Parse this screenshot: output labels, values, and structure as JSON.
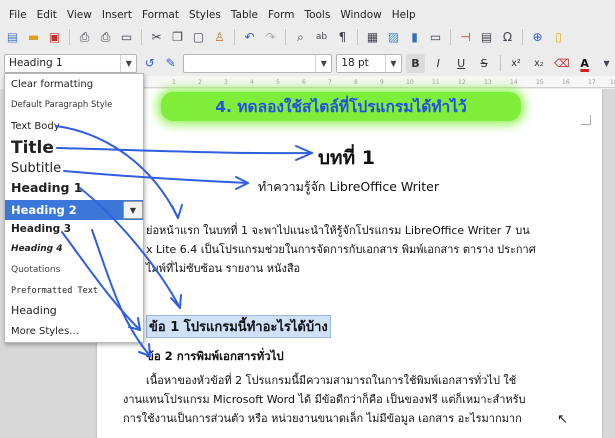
{
  "menubar": [
    "File",
    "Edit",
    "View",
    "Insert",
    "Format",
    "Styles",
    "Table",
    "Form",
    "Tools",
    "Window",
    "Help"
  ],
  "toolbar1_icons": [
    "new-document-icon",
    "open-icon",
    "save-icon",
    "export-pdf-icon",
    "print-icon",
    "print-preview-icon",
    "cut-icon",
    "copy-icon",
    "paste-icon",
    "clone-formatting-icon",
    "undo-icon",
    "redo-icon",
    "find-replace-icon",
    "spelling-icon",
    "formatting-marks-icon",
    "insert-table-icon",
    "insert-image-icon",
    "insert-chart-icon",
    "insert-textbox-icon",
    "page-break-icon",
    "insert-field-icon",
    "special-character-icon",
    "hyperlink-icon",
    "comment-icon"
  ],
  "toolbar2": {
    "paragraph_style": "Heading 1",
    "font_name": "",
    "font_size": "18 pt",
    "bold": "B",
    "italic": "I",
    "underline": "U",
    "strike": "S",
    "superscript": "x²",
    "subscript": "x₂"
  },
  "ruler_marks": [
    "1",
    "2",
    "3",
    "4",
    "5",
    "6",
    "7",
    "8",
    "9",
    "10",
    "11",
    "12",
    "13",
    "14",
    "15",
    "16",
    "17",
    "18"
  ],
  "dropdown": {
    "items": [
      "Clear formatting",
      "Default Paragraph Style",
      "Text Body",
      "Title",
      "Subtitle",
      "Heading 1",
      "Heading 2",
      "Heading 3",
      "Heading 4",
      "Quotations",
      "Preformatted Text",
      "Heading",
      "More Styles..."
    ],
    "selected": "Heading 2"
  },
  "document": {
    "banner": "4. ทดลองใช้สไตล์ที่โปรแกรมได้ทำไว้",
    "title": "บทที่ 1",
    "subtitle": "ทำความรู้จัก LibreOffice Writer",
    "body1": "ย่อหน้าแรก ในบทที่ 1 จะพาไปแนะนำให้รู้จักโปรแกรม LibreOffice Writer 7 บน",
    "body2": "x Lite 6.4 เป็นโปรแกรมช่วยในการจัดการกับเอกสาร พิมพ์เอกสาร ตาราง ประกาศ",
    "body3": "ไมพ์ที่ไม่ซับซ้อน รายงาน หนังสือ",
    "heading2": "ข้อ 1 โปรแกรมนี้ทำอะไรได้บ้าง",
    "heading3": "ข้อ 2  การพิมพ์เอกสารทั่วไป",
    "para1": "เนื้อหาของหัวข้อที่ 2 โปรแกรมนี้มีความสามารถในการใช้พิมพ์เอกสารทั่วไป ใช้",
    "para2": "งานแทนโปรแกรม Microsoft Word ได้ มีข้อดีกว่าก็คือ เป็นของฟรี แต่ก็เหมาะสำหรับ",
    "para3": "การใช้งานเป็นการส่วนตัว หรือ หน่วยงานขนาดเล็ก ไม่มีข้อมูล เอกสาร อะไรมากมาก"
  },
  "colors": {
    "annotation_arrow": "#2f5fe0",
    "banner_bg": "#7fee3a",
    "banner_text": "#2350e0",
    "selection": "#3b77d8"
  }
}
